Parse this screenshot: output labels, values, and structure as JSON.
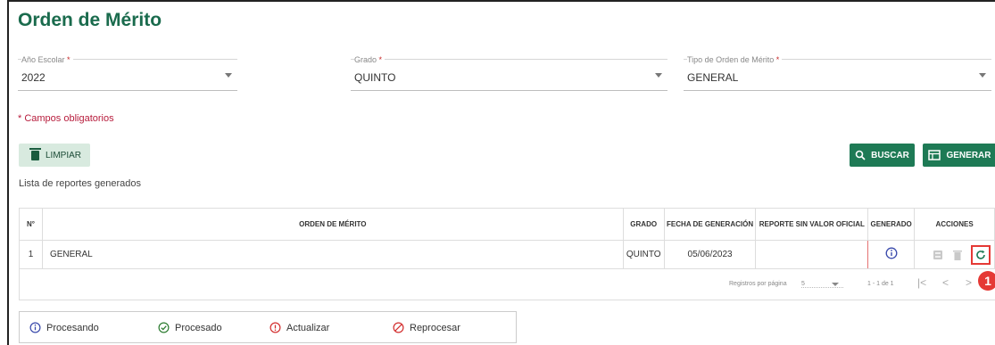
{
  "page": {
    "title": "Orden de Mérito"
  },
  "filters": {
    "year": {
      "label": "Año Escolar",
      "value": "2022"
    },
    "grade": {
      "label": "Grado",
      "value": "QUINTO"
    },
    "type": {
      "label": "Tipo de Orden de Mérito",
      "value": "GENERAL"
    },
    "required_mark": "*"
  },
  "required_note": "* Campos obligatorios",
  "buttons": {
    "clear": "LIMPIAR",
    "search": "BUSCAR",
    "generate": "GENERAR"
  },
  "list_title": "Lista de reportes generados",
  "table": {
    "headers": [
      "N°",
      "ORDEN DE MÉRITO",
      "GRADO",
      "FECHA DE GENERACIÓN",
      "REPORTE SIN VALOR OFICIAL",
      "GENERADO",
      "ACCIONES"
    ],
    "rows": [
      {
        "n": "1",
        "orden": "GENERAL",
        "grado": "QUINTO",
        "fecha": "05/06/2023",
        "reporte": "",
        "generado_icon": "info-circle-icon"
      }
    ]
  },
  "pagination": {
    "label": "Registros por página",
    "per_page": "5",
    "range": "1 - 1 de 1"
  },
  "annotation_badge": "1",
  "legend": [
    {
      "label": "Procesando",
      "color": "#3949ab",
      "icon": "info-circle-icon"
    },
    {
      "label": "Procesado",
      "color": "#2e7d32",
      "icon": "check-circle-icon"
    },
    {
      "label": "Actualizar",
      "color": "#d32f2f",
      "icon": "exclamation-circle-icon"
    },
    {
      "label": "Reprocesar",
      "color": "#d32f2f",
      "icon": "prohibited-icon"
    }
  ],
  "colors": {
    "brand": "#1a6b4d",
    "button": "#1e7a55",
    "required": "#b71c3c"
  }
}
